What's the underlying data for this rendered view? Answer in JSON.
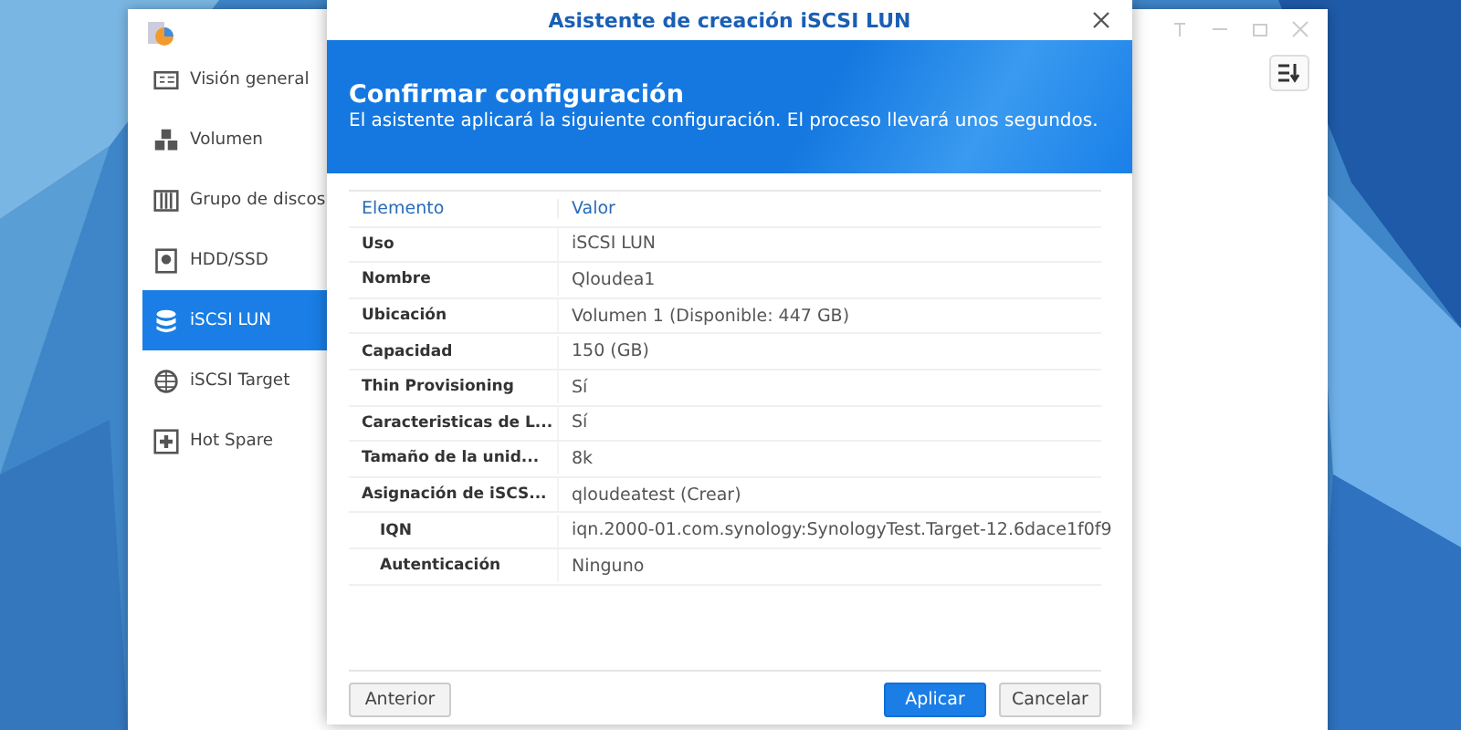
{
  "sidebar": {
    "items": [
      {
        "label": "Visión general",
        "selected": false
      },
      {
        "label": "Volumen",
        "selected": false
      },
      {
        "label": "Grupo de discos",
        "selected": false
      },
      {
        "label": "HDD/SSD",
        "selected": false
      },
      {
        "label": "iSCSI LUN",
        "selected": true
      },
      {
        "label": "iSCSI Target",
        "selected": false
      },
      {
        "label": "Hot Spare",
        "selected": false
      }
    ]
  },
  "dialog": {
    "title": "Asistente de creación iSCSI LUN",
    "heading": "Confirmar configuración",
    "description": "El asistente aplicará la siguiente configuración. El proceso llevará unos segundos.",
    "table": {
      "columns": [
        "Elemento",
        "Valor"
      ],
      "rows": [
        {
          "item": "Uso",
          "value": "iSCSI LUN",
          "nested": false
        },
        {
          "item": "Nombre",
          "value": "Qloudea1",
          "nested": false
        },
        {
          "item": "Ubicación",
          "value": "Volumen 1 (Disponible: 447 GB)",
          "nested": false
        },
        {
          "item": "Capacidad",
          "value": "150 (GB)",
          "nested": false
        },
        {
          "item": "Thin Provisioning",
          "value": "Sí",
          "nested": false
        },
        {
          "item": "Caracteristicas de L...",
          "value": "Sí",
          "nested": false
        },
        {
          "item": "Tamaño de la unid...",
          "value": "8k",
          "nested": false
        },
        {
          "item": "Asignación de iSCS...",
          "value": "qloudeatest (Crear)",
          "nested": false
        },
        {
          "item": "IQN",
          "value": "iqn.2000-01.com.synology:SynologyTest.Target-12.6dace1f0f9",
          "nested": true
        },
        {
          "item": "Autenticación",
          "value": "Ninguno",
          "nested": true
        }
      ]
    },
    "buttons": [
      {
        "label": "Anterior",
        "primary": false
      },
      {
        "label": "Aplicar",
        "primary": true
      },
      {
        "label": "Cancelar",
        "primary": false
      }
    ]
  }
}
